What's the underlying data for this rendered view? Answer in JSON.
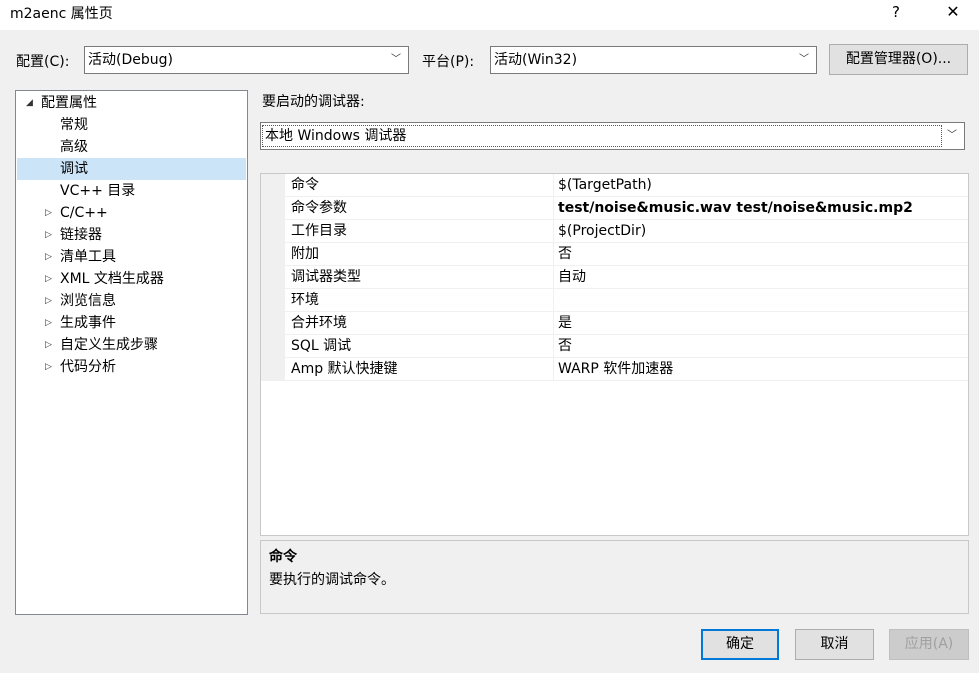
{
  "window": {
    "title": "m2aenc 属性页",
    "help_glyph": "?",
    "close_glyph": "✕"
  },
  "toolbar": {
    "config_label": "配置(C):",
    "config_value": "活动(Debug)",
    "platform_label": "平台(P):",
    "platform_value": "活动(Win32)",
    "config_manager_label": "配置管理器(O)..."
  },
  "tree": {
    "items": [
      {
        "label": "配置属性",
        "expander": "◢",
        "level": 0
      },
      {
        "label": "常规",
        "expander": "",
        "level": 1
      },
      {
        "label": "高级",
        "expander": "",
        "level": 1
      },
      {
        "label": "调试",
        "expander": "",
        "level": 1,
        "selected": true
      },
      {
        "label": "VC++ 目录",
        "expander": "",
        "level": 1
      },
      {
        "label": "C/C++",
        "expander": "▷",
        "level": 1
      },
      {
        "label": "链接器",
        "expander": "▷",
        "level": 1
      },
      {
        "label": "清单工具",
        "expander": "▷",
        "level": 1
      },
      {
        "label": "XML 文档生成器",
        "expander": "▷",
        "level": 1
      },
      {
        "label": "浏览信息",
        "expander": "▷",
        "level": 1
      },
      {
        "label": "生成事件",
        "expander": "▷",
        "level": 1
      },
      {
        "label": "自定义生成步骤",
        "expander": "▷",
        "level": 1
      },
      {
        "label": "代码分析",
        "expander": "▷",
        "level": 1
      }
    ]
  },
  "debugger": {
    "label": "要启动的调试器:",
    "value": "本地 Windows 调试器"
  },
  "properties": [
    {
      "name": "命令",
      "value": "$(TargetPath)",
      "bold": false
    },
    {
      "name": "命令参数",
      "value": "test/noise&music.wav test/noise&music.mp2",
      "bold": true
    },
    {
      "name": "工作目录",
      "value": "$(ProjectDir)",
      "bold": false
    },
    {
      "name": "附加",
      "value": "否",
      "bold": false
    },
    {
      "name": "调试器类型",
      "value": "自动",
      "bold": false
    },
    {
      "name": "环境",
      "value": "",
      "bold": false
    },
    {
      "name": "合并环境",
      "value": "是",
      "bold": false
    },
    {
      "name": "SQL 调试",
      "value": "否",
      "bold": false
    },
    {
      "name": "Amp 默认快捷键",
      "value": "WARP 软件加速器",
      "bold": false
    }
  ],
  "description": {
    "title": "命令",
    "text": "要执行的调试命令。"
  },
  "buttons": {
    "ok": "确定",
    "cancel": "取消",
    "apply": "应用(A)"
  },
  "colors": {
    "selection": "#cce4f7",
    "default_button_border": "#0078d7",
    "window_bg": "#f0f0f0"
  }
}
